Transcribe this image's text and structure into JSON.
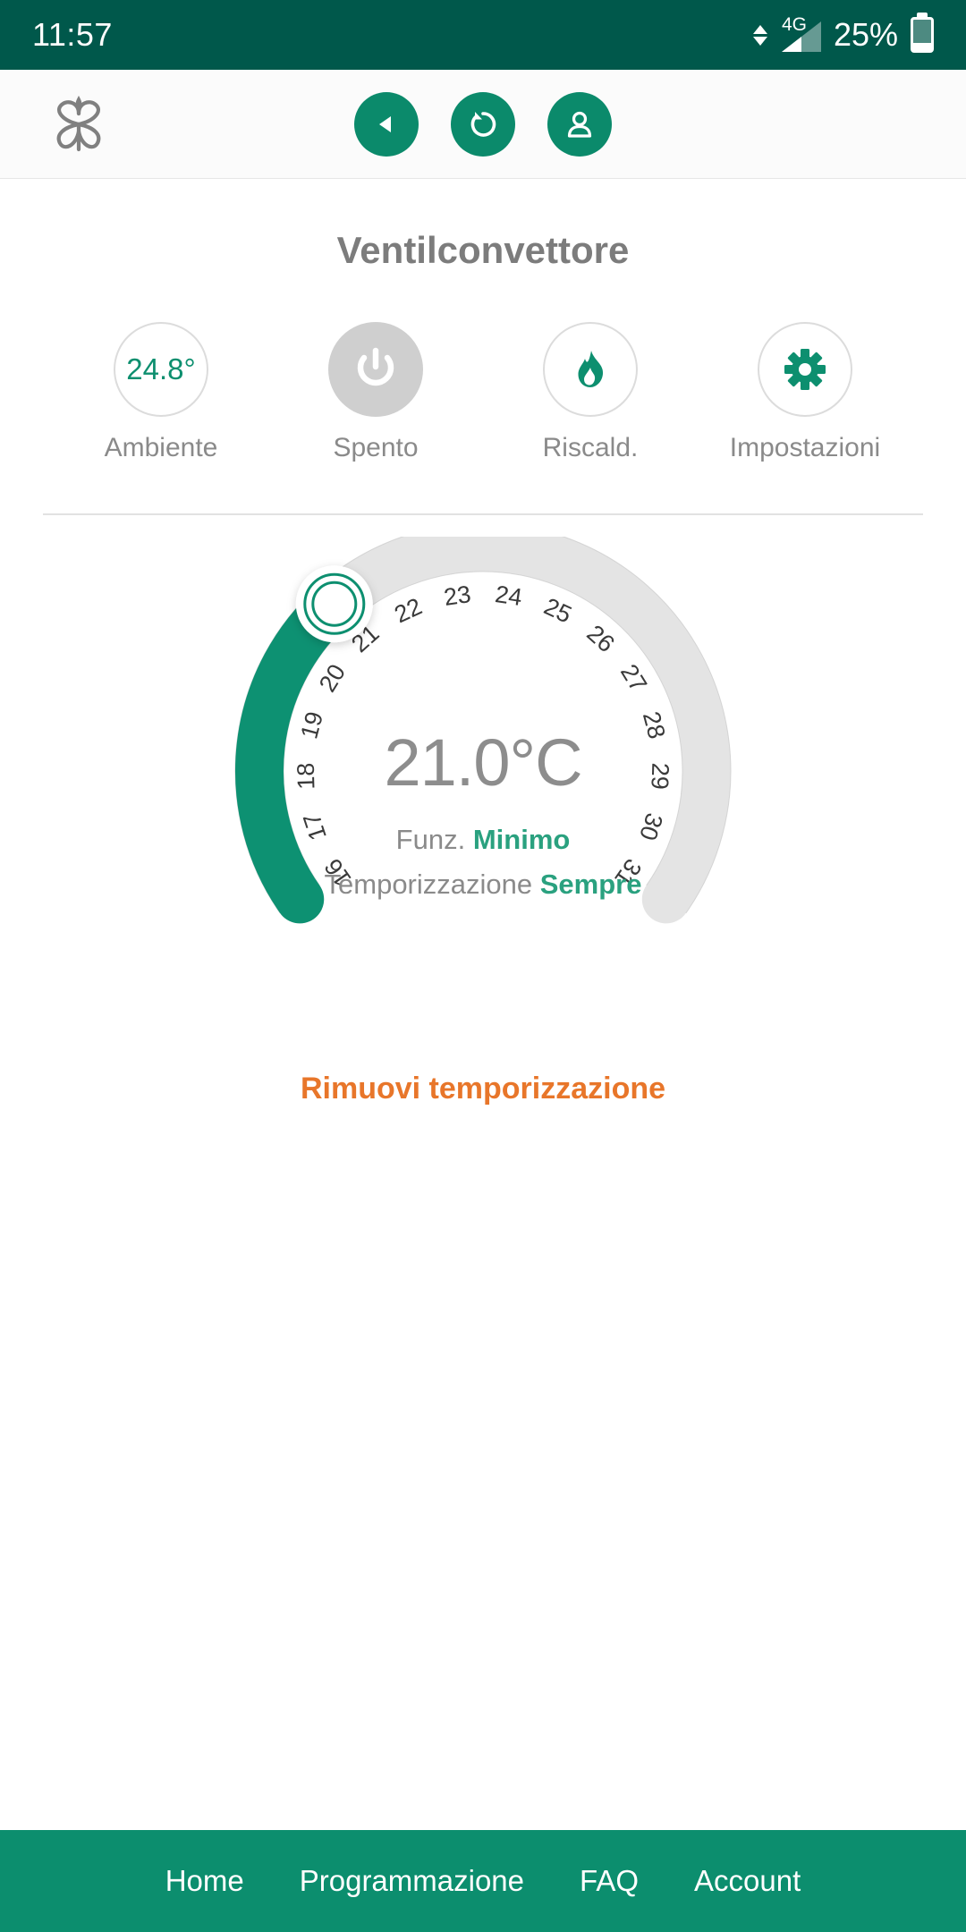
{
  "status_bar": {
    "time": "11:57",
    "network_type": "4G",
    "battery_percent": "25%",
    "battery_level": 25,
    "icons": [
      "data-transfer-icon",
      "signal-bars-icon",
      "battery-icon"
    ]
  },
  "app_header": {
    "logo": "butterfly-logo",
    "buttons": [
      {
        "name": "back-button",
        "icon": "back-triangle-icon"
      },
      {
        "name": "refresh-button",
        "icon": "refresh-icon"
      },
      {
        "name": "account-button",
        "icon": "person-icon"
      }
    ]
  },
  "page": {
    "title": "Ventilconvettore"
  },
  "controls": [
    {
      "name": "ambient-temperature",
      "icon": "thermometer-value",
      "value": "24.8°",
      "label": "Ambiente",
      "style": "outline"
    },
    {
      "name": "power-state",
      "icon": "power-icon",
      "value": "",
      "label": "Spento",
      "style": "filled"
    },
    {
      "name": "mode-heating",
      "icon": "flame-icon",
      "value": "",
      "label": "Riscald.",
      "style": "outline"
    },
    {
      "name": "settings",
      "icon": "gear-icon",
      "value": "",
      "label": "Impostazioni",
      "style": "outline"
    }
  ],
  "dial": {
    "setpoint_display": "21.0°C",
    "setpoint_value": 21,
    "min": 16,
    "max": 31,
    "ticks": [
      16,
      17,
      18,
      19,
      20,
      21,
      22,
      23,
      24,
      25,
      26,
      27,
      28,
      29,
      30,
      31
    ],
    "function_label": "Funz.",
    "function_value": "Minimo",
    "timer_label": "Temporizzazione",
    "timer_value": "Sempre",
    "handle": "dial-handle"
  },
  "remove_timer_link": "Rimuovi temporizzazione",
  "bottom_nav": [
    {
      "name": "nav-home",
      "label": "Home"
    },
    {
      "name": "nav-programmazione",
      "label": "Programmazione"
    },
    {
      "name": "nav-faq",
      "label": "FAQ"
    },
    {
      "name": "nav-account",
      "label": "Account"
    }
  ],
  "colors": {
    "status_bar_green": "#00584b",
    "brand_green": "#0b8a6b",
    "arc_green": "#0d9172",
    "arc_track_gray": "#e4e4e4",
    "accent_green_text": "#2aa17f",
    "orange_link": "#e8762a",
    "bottom_nav_green": "#0c8e6e"
  }
}
